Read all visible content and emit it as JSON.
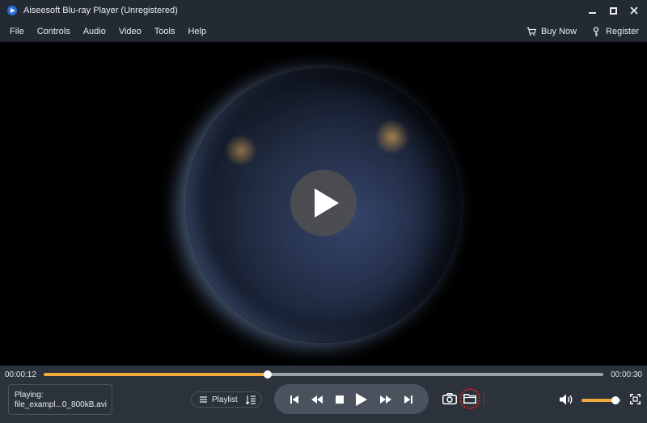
{
  "window": {
    "title": "Aiseesoft Blu-ray Player (Unregistered)",
    "icons": [
      "app-logo-icon",
      "minimize-icon",
      "maximize-icon",
      "close-icon"
    ]
  },
  "menu": {
    "items": [
      {
        "label": "File"
      },
      {
        "label": "Controls"
      },
      {
        "label": "Audio"
      },
      {
        "label": "Video"
      },
      {
        "label": "Tools"
      },
      {
        "label": "Help"
      }
    ],
    "buy_now": "Buy Now",
    "register": "Register"
  },
  "player": {
    "current_time": "00:00:12",
    "total_time": "00:00:30",
    "progress_fraction": 0.4,
    "volume_fraction": 0.88,
    "now_playing_label": "Playing:",
    "now_playing_file": "file_exampl...0_800kB.avi",
    "playlist_label": "Playlist"
  },
  "colors": {
    "accent": "#f2a93b",
    "panel": "#2b323c",
    "titlebar": "#232a34",
    "highlight_ring": "#e02020"
  }
}
